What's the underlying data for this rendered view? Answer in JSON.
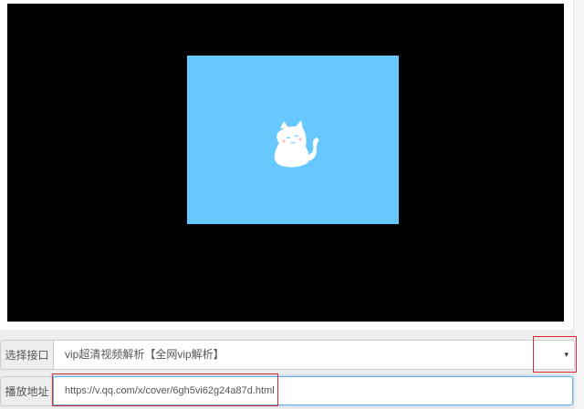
{
  "player": {
    "poster_color": "#66c8ff",
    "mascot_icon": "cat-mascot-icon"
  },
  "interface_row": {
    "label": "选择接口",
    "selected": "vip超清视频解析【全网vip解析】",
    "arrow": "▾"
  },
  "address_row": {
    "label": "播放地址",
    "value": "https://v.qq.com/x/cover/6gh5vi62g24a87d.html"
  },
  "colors": {
    "highlight": "#d9262b",
    "player_bg": "#000000"
  }
}
